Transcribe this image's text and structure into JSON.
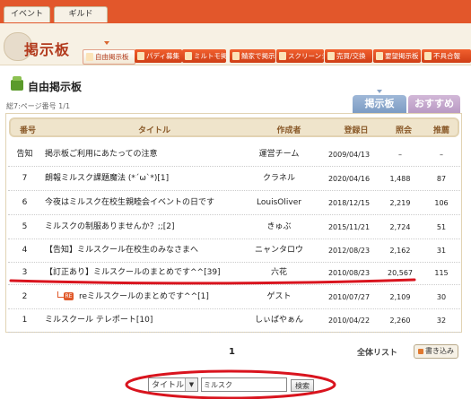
{
  "top_tabs": [
    "イベント",
    "ギルド"
  ],
  "logo": "掲示板",
  "nav": [
    "自由掲示板",
    "パディ募集",
    "ミルトモ掲示板",
    "鯖家で掲示板",
    "スクリーンショット",
    "売買/交換",
    "要望掲示板",
    "不具合報"
  ],
  "board_title": "自由掲示板",
  "page_info": "総7:ページ番号 1/1",
  "tabs": {
    "board": "掲示板",
    "recommended": "おすすめ"
  },
  "columns": [
    "番号",
    "タイトル",
    "作成者",
    "登録日",
    "照会",
    "推薦"
  ],
  "rows": [
    {
      "no": "告知",
      "title": "掲示板ご利用にあたっての注意",
      "author": "運営チーム",
      "date": "2009/04/13",
      "views": "–",
      "rec": "–"
    },
    {
      "no": "7",
      "title": "朗報ミルスク課題魔法 (*´ω`*)[1]",
      "author": "クラネル",
      "date": "2020/04/16",
      "views": "1,488",
      "rec": "87"
    },
    {
      "no": "6",
      "title": "今夜はミルスク在校生親睦会イベントの日です",
      "author": "LouisOliver",
      "date": "2018/12/15",
      "views": "2,219",
      "rec": "106"
    },
    {
      "no": "5",
      "title": "ミルスクの制服ありませんか？;;[2]",
      "author": "きゅぶ",
      "date": "2015/11/21",
      "views": "2,724",
      "rec": "51"
    },
    {
      "no": "4",
      "title": "【告知】ミルスクール在校生のみなさまへ",
      "author": "ニャンタロウ",
      "date": "2012/08/23",
      "views": "2,162",
      "rec": "31"
    },
    {
      "no": "3",
      "title": "【訂正あり】ミルスクールのまとめです^^[39]",
      "author": "六花",
      "date": "2010/08/23",
      "views": "20,567",
      "rec": "115"
    },
    {
      "no": "2",
      "title": "reミルスクールのまとめです^^[1]",
      "author": "ゲスト",
      "date": "2010/07/27",
      "views": "2,109",
      "rec": "30"
    },
    {
      "no": "1",
      "title": "ミルスクール テレポート[10]",
      "author": "しぃばやぁん",
      "date": "2010/04/22",
      "views": "2,260",
      "rec": "32"
    }
  ],
  "reply_badge": "RE",
  "pagination": "1",
  "all_list": "全体リスト",
  "write_button": "書き込み",
  "search": {
    "select": "タイトル",
    "select_arrow": "▼",
    "value": "ミルスク",
    "button": "検索"
  },
  "colors": {
    "header_red": "#e2572b",
    "annotation_red": "#d9141e",
    "table_header_bg": "#efe4cb"
  }
}
